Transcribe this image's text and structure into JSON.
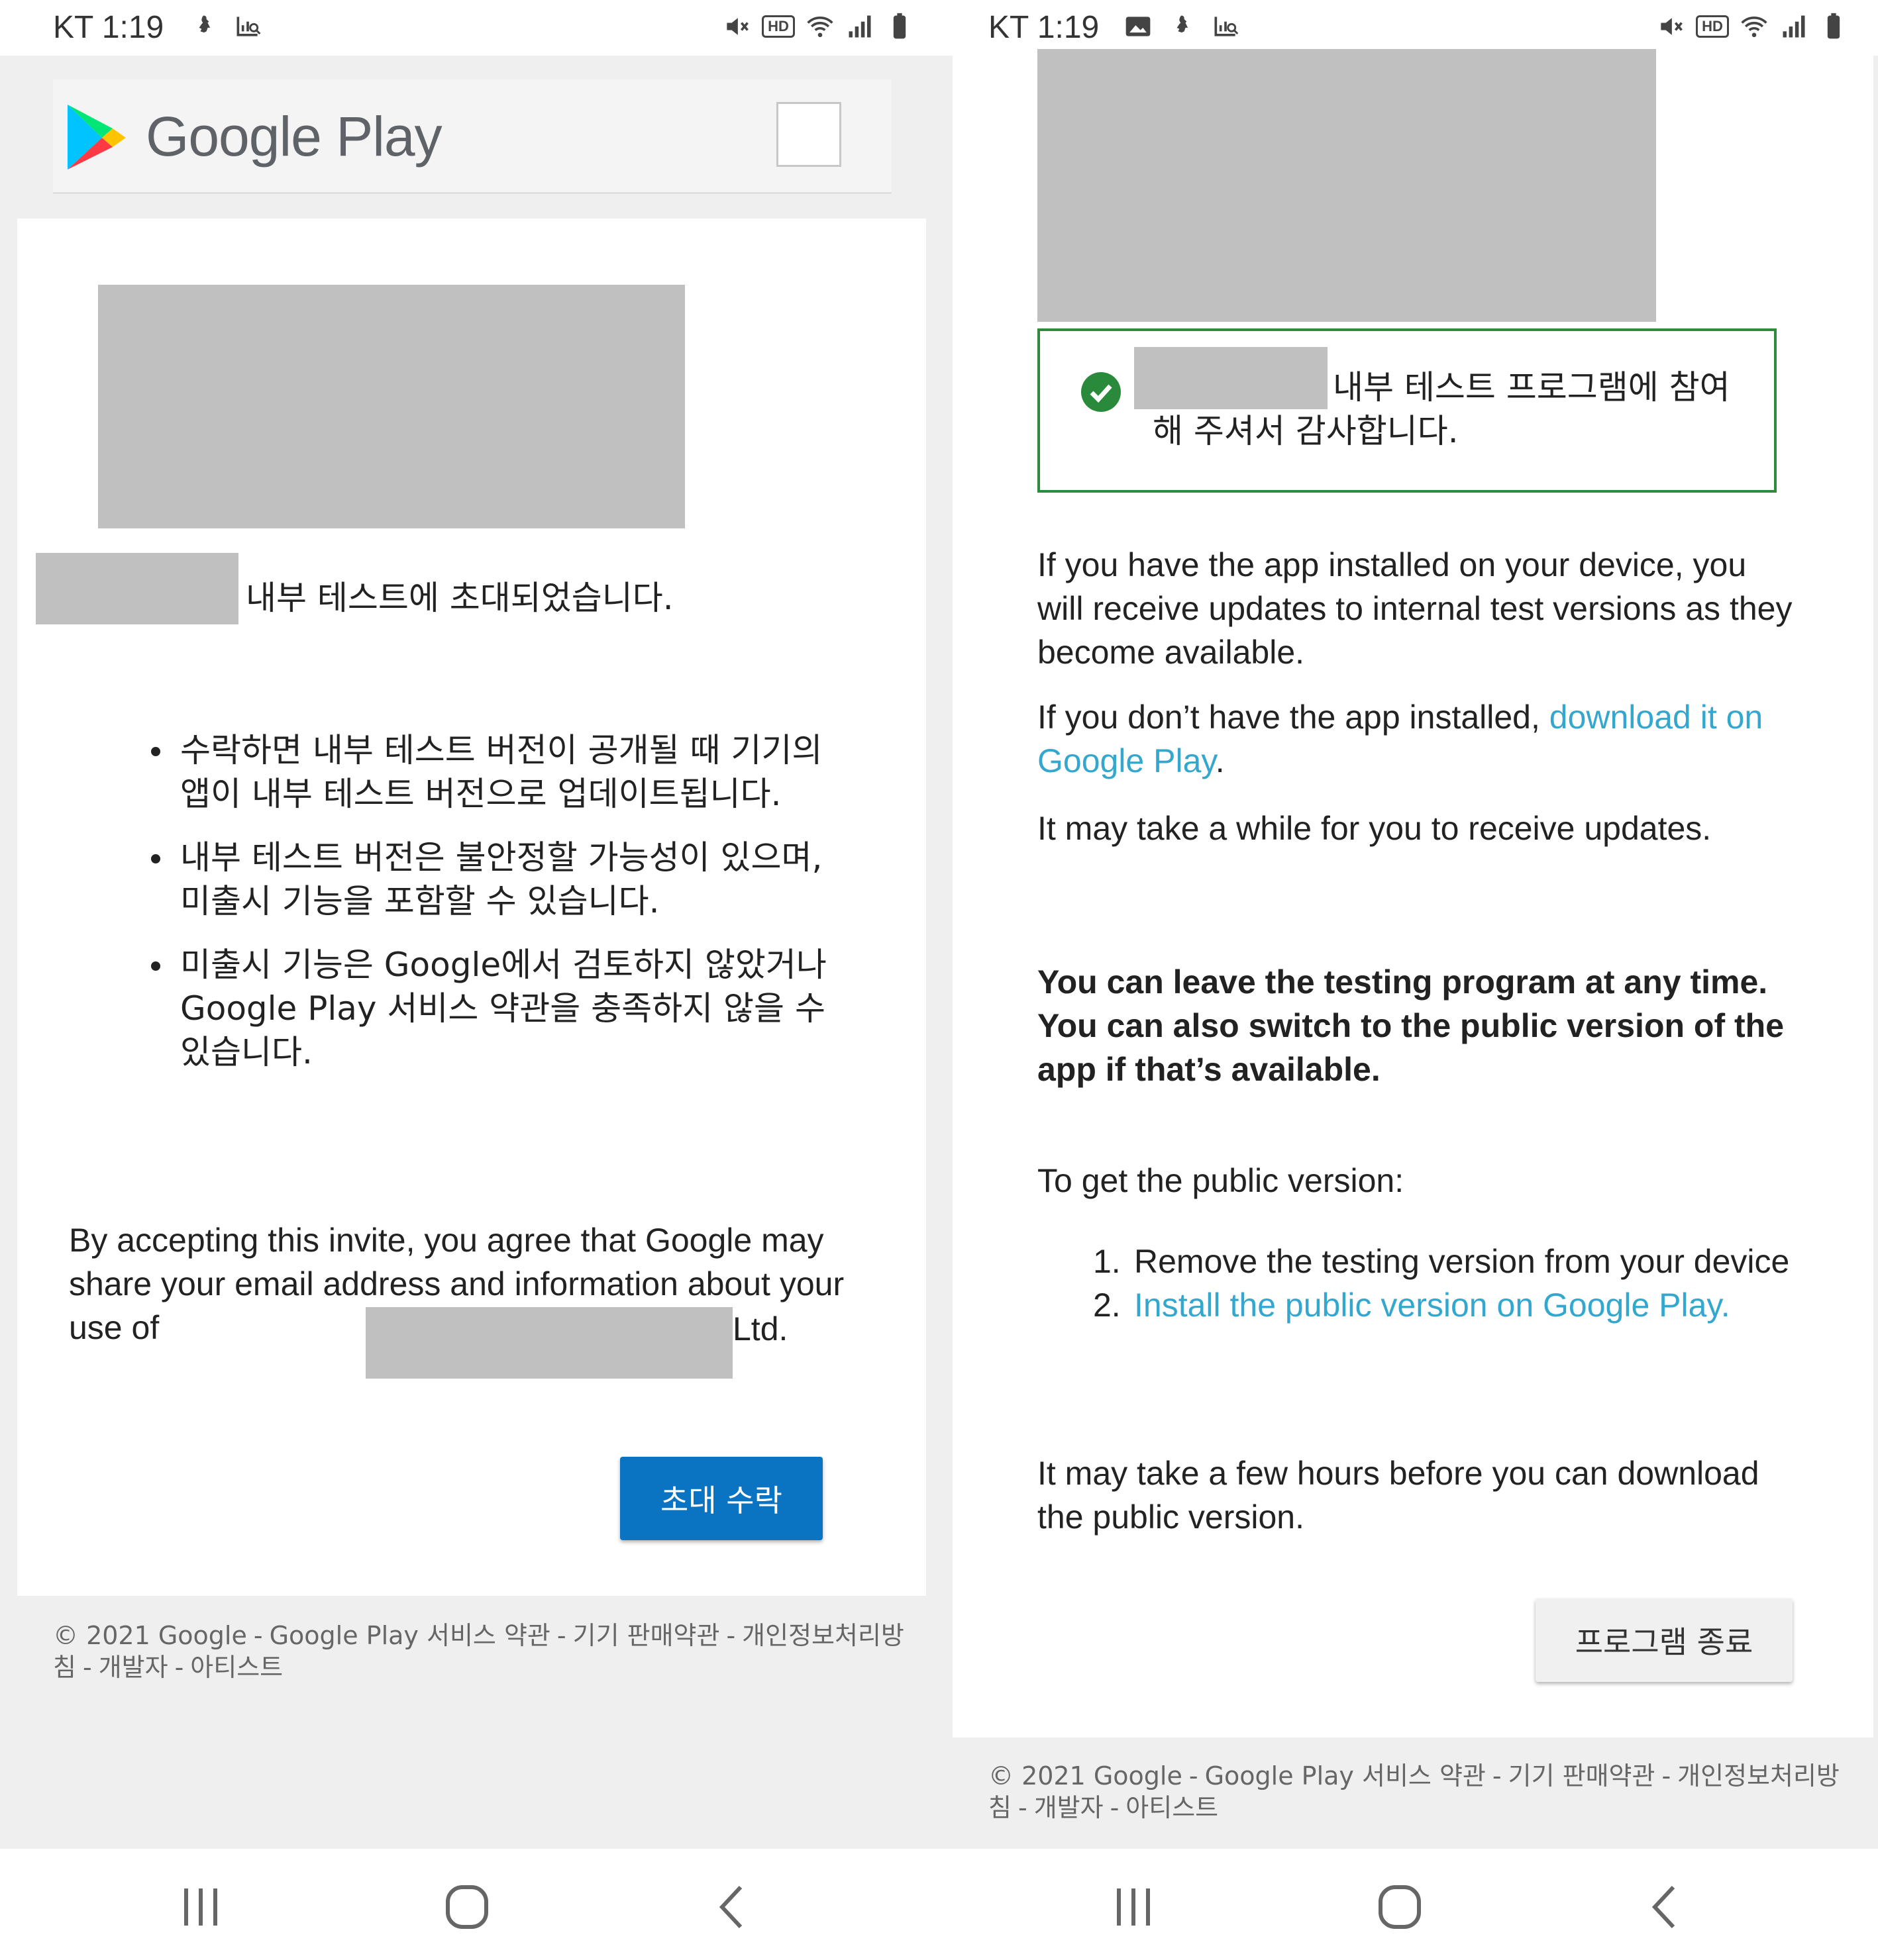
{
  "status_bar": {
    "carrier": "KT",
    "time": "1:19",
    "hd_label": "HD"
  },
  "left": {
    "header": {
      "logo_text": "Google Play"
    },
    "invite_line": "내부 테스트에 초대되었습니다.",
    "bullets": [
      "수락하면 내부 테스트 버전이 공개될 때 기기의 앱이 내부 테스트 버전으로 업데이트됩니다.",
      "내부 테스트 버전은 불안정할 가능성이 있으며, 미출시 기능을 포함할 수 있습니다.",
      "미출시 기능은 Google에서 검토하지 않았거나 Google Play 서비스 약관을 충족하지 않을 수 있습니다."
    ],
    "consent_text": "By accepting this invite, you agree that Google may share your email address and information about your use of",
    "consent_suffix": "Ltd.",
    "accept_button": "초대 수락"
  },
  "right": {
    "thanks_text": "내부 테스트 프로그램에 참여해 주셔서 감사합니다.",
    "para1": "If you have the app installed on your device, you will receive updates to internal test versions as they become available.",
    "para2_prefix": "If you don’t have the app installed, ",
    "para2_link": "download it on Google Play",
    "para2_suffix": ".",
    "para3": "It may take a while for you to receive updates.",
    "bold_notice": "You can leave the testing program at any time. You can also switch to the public version of the app if that’s available.",
    "public_intro": "To get the public version:",
    "steps": [
      {
        "num": "1.",
        "text": "Remove the testing version from your device",
        "link": false
      },
      {
        "num": "2.",
        "text": "Install the public version on Google Play.",
        "link": true
      }
    ],
    "para4": "It may take a few hours before you can download the public version.",
    "exit_button": "프로그램 종료"
  },
  "footer": {
    "copyright": "© 2021 Google",
    "links": [
      "Google Play 서비스 약관",
      "기기 판매약관",
      "개인정보처리방침",
      "개발자",
      "아티스트"
    ]
  },
  "colors": {
    "accept_button": "#0a73c2",
    "link": "#34a7cf",
    "success_border": "#2e8b3b",
    "redaction": "#c0c0c0"
  },
  "icons": {
    "status_left": [
      "notification-icon",
      "analytics-icon"
    ],
    "status_left_right_phone": [
      "image-icon",
      "notification-icon",
      "analytics-icon"
    ],
    "status_right": [
      "mute-icon",
      "hd-icon",
      "wifi-icon",
      "signal-icon",
      "battery-icon"
    ],
    "nav": [
      "recents-icon",
      "home-icon",
      "back-icon"
    ]
  }
}
